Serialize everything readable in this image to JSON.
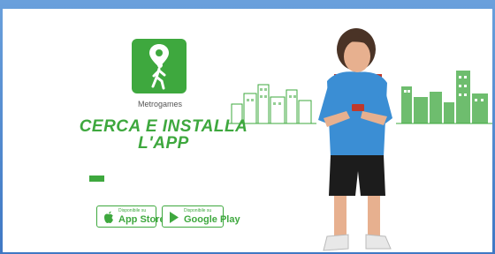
{
  "app": {
    "name": "Metrogames"
  },
  "headline": {
    "line1": "CERCA E INSTALLA",
    "line2": "L'APP"
  },
  "stores": [
    {
      "small": "Disponibile su",
      "big": "App Store",
      "icon": "apple-icon"
    },
    {
      "small": "Disponibile su",
      "big": "Google Play",
      "icon": "google-play-icon"
    }
  ],
  "colors": {
    "accent": "#3ea83e",
    "frame": "#4f86cc",
    "background": "#ffffff"
  }
}
